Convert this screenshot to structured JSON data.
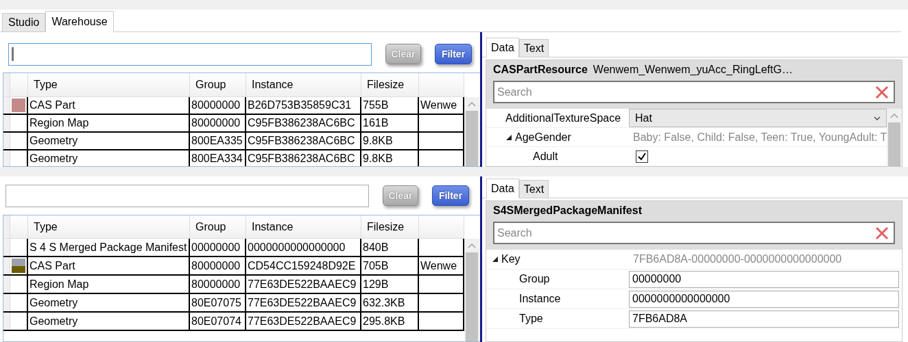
{
  "panels": [
    {
      "app_tabs": [
        {
          "label": "Studio",
          "selected": false
        },
        {
          "label": "Warehouse",
          "selected": true
        }
      ],
      "filter_field": {
        "focused": true
      },
      "clear_button": "Clear",
      "filter_button": "Filter",
      "columns": [
        "Type",
        "Group",
        "Instance",
        "Filesize"
      ],
      "rows": [
        {
          "swatch": [
            {
              "color": "#c48a8a"
            }
          ],
          "type": "CAS Part",
          "group": "80000000",
          "instance": "B26D753B35859C31",
          "filesize": "755B",
          "column_5": "Wenwe"
        },
        {
          "type": "Region Map",
          "group": "80000000",
          "instance": "C95FB386238AC6BC",
          "filesize": "161B"
        },
        {
          "type": "Geometry",
          "group": "800EA335",
          "instance": "C95FB386238AC6BC",
          "filesize": "9.8KB"
        },
        {
          "type": "Geometry",
          "group": "800EA334",
          "instance": "C95FB386238AC6BC",
          "filesize": "9.8KB"
        }
      ],
      "details": {
        "tabs": [
          {
            "label": "Data",
            "selected": true
          },
          {
            "label": "Text",
            "selected": false
          }
        ],
        "title": "CASPartResource",
        "subtitle": "Wenwem_Wenwem_yuAcc_RingLeftG…",
        "search_placeholder": "Search",
        "properties": [
          {
            "kind": "combo",
            "name": "AdditionalTextureSpace",
            "value": "Hat"
          },
          {
            "kind": "group",
            "name": "AgeGender",
            "expanded": true,
            "value": "Baby: False, Child: False, Teen: True, YoungAdult: T",
            "children": [
              {
                "kind": "checkbox",
                "name": "Adult",
                "checked": true
              }
            ]
          }
        ]
      }
    },
    {
      "filter_field": {
        "focused": false
      },
      "clear_button": "Clear",
      "filter_button": "Filter",
      "columns": [
        "Type",
        "Group",
        "Instance",
        "Filesize"
      ],
      "rows": [
        {
          "type": "S 4 S Merged Package Manifest",
          "group": "00000000",
          "instance": "0000000000000000",
          "filesize": "840B"
        },
        {
          "swatch": [
            {
              "color": "#9aa1aa"
            },
            {
              "color": "#6e5c00"
            }
          ],
          "type": "CAS Part",
          "group": "80000000",
          "instance": "CD54CC159248D92E",
          "filesize": "705B",
          "column_5": "Wenwe"
        },
        {
          "type": "Region Map",
          "group": "80000000",
          "instance": "77E63DE522BAAEC9",
          "filesize": "129B"
        },
        {
          "type": "Geometry",
          "group": "80E07075",
          "instance": "77E63DE522BAAEC9",
          "filesize": "632.3KB"
        },
        {
          "type": "Geometry",
          "group": "80E07074",
          "instance": "77E63DE522BAAEC9",
          "filesize": "295.8KB"
        }
      ],
      "details": {
        "tabs": [
          {
            "label": "Data",
            "selected": true
          },
          {
            "label": "Text",
            "selected": false
          }
        ],
        "title": "S4SMergedPackageManifest",
        "search_placeholder": "Search",
        "properties": [
          {
            "kind": "group",
            "name": "Key",
            "expanded": true,
            "value": "7FB6AD8A-00000000-0000000000000000",
            "children": [
              {
                "kind": "field",
                "name": "Group",
                "value": "00000000"
              },
              {
                "kind": "field",
                "name": "Instance",
                "value": "0000000000000000"
              },
              {
                "kind": "field",
                "name": "Type",
                "value": "7FB6AD8A"
              }
            ]
          }
        ]
      }
    }
  ]
}
